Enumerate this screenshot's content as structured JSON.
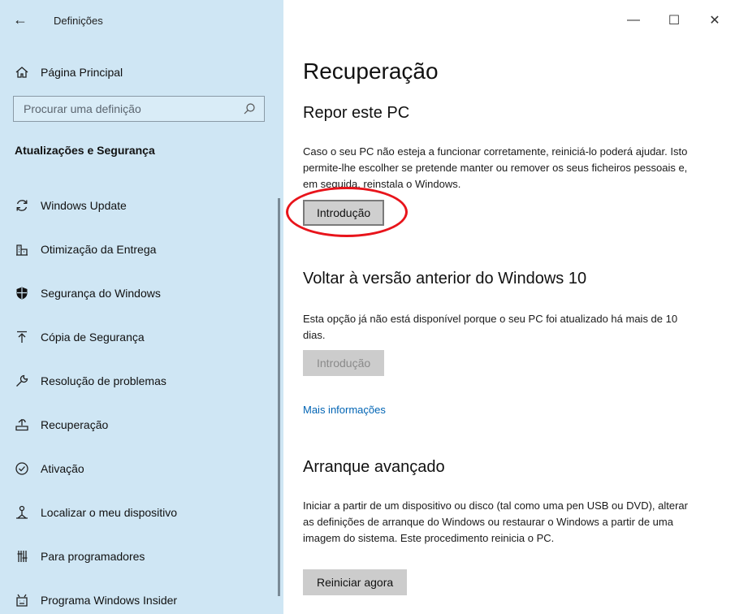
{
  "window": {
    "app_title": "Definições",
    "controls": {
      "minimize": "—",
      "maximize": "☐",
      "close": "✕"
    }
  },
  "sidebar": {
    "home_label": "Página Principal",
    "search_placeholder": "Procurar uma definição",
    "section_heading": "Atualizações e Segurança",
    "items": [
      {
        "label": "Windows Update",
        "icon": "refresh-icon"
      },
      {
        "label": "Otimização da Entrega",
        "icon": "delivery-icon"
      },
      {
        "label": "Segurança do Windows",
        "icon": "shield-icon"
      },
      {
        "label": "Cópia de Segurança",
        "icon": "backup-icon"
      },
      {
        "label": "Resolução de problemas",
        "icon": "wrench-icon"
      },
      {
        "label": "Recuperação",
        "icon": "recovery-icon"
      },
      {
        "label": "Ativação",
        "icon": "check-circle-icon"
      },
      {
        "label": "Localizar o meu dispositivo",
        "icon": "find-device-icon"
      },
      {
        "label": "Para programadores",
        "icon": "developer-icon"
      },
      {
        "label": "Programa Windows Insider",
        "icon": "insider-icon"
      }
    ]
  },
  "main": {
    "title": "Recuperação",
    "reset": {
      "heading": "Repor este PC",
      "description": "Caso o seu PC não esteja a funcionar corretamente, reiniciá-lo poderá ajudar. Isto permite-lhe escolher se pretende manter ou remover os seus ficheiros pessoais e, em seguida, reinstala o Windows.",
      "button": "Introdução"
    },
    "rollback": {
      "heading": "Voltar à versão anterior do Windows 10",
      "description": "Esta opção já não está disponível porque o seu PC foi atualizado há mais de 10 dias.",
      "button": "Introdução",
      "link": "Mais informações"
    },
    "advanced": {
      "heading": "Arranque avançado",
      "description": "Iniciar a partir de um dispositivo ou disco (tal como uma pen USB ou DVD), alterar as definições de arranque do Windows ou restaurar o Windows a partir de uma imagem do sistema. Este procedimento reinicia o PC.",
      "button": "Reiniciar agora"
    }
  },
  "colors": {
    "sidebar_bg": "#cfe6f4",
    "link": "#0064b4",
    "annotation_ring": "#e8141b"
  }
}
